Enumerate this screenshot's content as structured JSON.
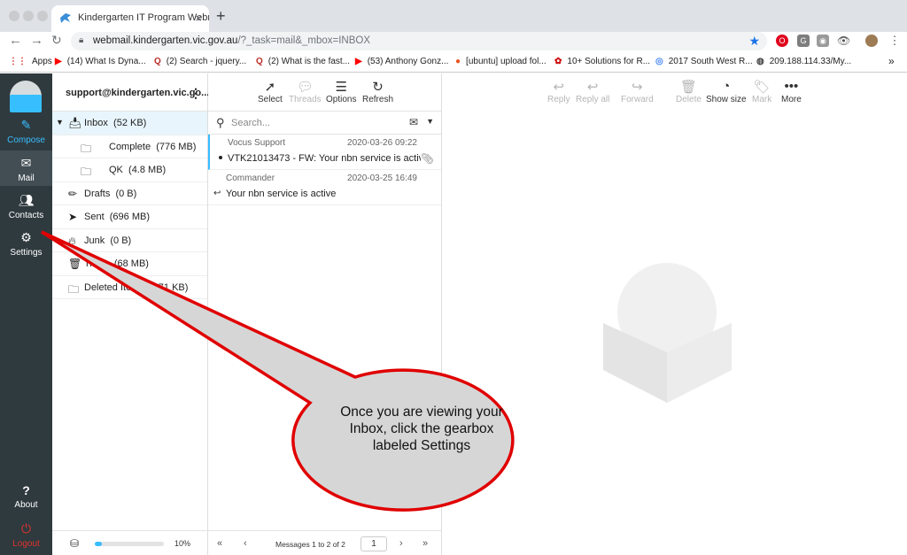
{
  "browser": {
    "tab_title": "Kindergarten IT Program Webmail",
    "url_main": "webmail.kindergarten.vic.gov.au",
    "url_rest": "/?_task=mail&_mbox=INBOX",
    "bookmarks": [
      {
        "icon": "Apps",
        "label": "Apps"
      },
      {
        "label": "(14) What Is Dyna..."
      },
      {
        "label": "(2) Search - jquery..."
      },
      {
        "label": "(2) What is the fast..."
      },
      {
        "label": "(53) Anthony Gonz..."
      },
      {
        "label": "[ubuntu] upload fol..."
      },
      {
        "label": "10+ Solutions for R..."
      },
      {
        "label": "2017 South West R..."
      },
      {
        "label": "209.188.114.33/My..."
      }
    ],
    "more": "»"
  },
  "nav": {
    "compose": "Compose",
    "mail": "Mail",
    "contacts": "Contacts",
    "settings": "Settings",
    "about": "About",
    "logout": "Logout"
  },
  "account": "support@kindergarten.vic.go...",
  "folders": [
    {
      "name": "Inbox",
      "size": "(52 KB)"
    },
    {
      "name": "Complete",
      "size": "(776 MB)"
    },
    {
      "name": "QK",
      "size": "(4.8 MB)"
    },
    {
      "name": "Drafts",
      "size": "(0 B)"
    },
    {
      "name": "Sent",
      "size": "(696 MB)"
    },
    {
      "name": "Junk",
      "size": "(0 B)"
    },
    {
      "name": "Trash",
      "size": "(68 MB)"
    },
    {
      "name": "Deleted Items",
      "size": "(271 KB)"
    }
  ],
  "quota": {
    "percent": 10,
    "label": "10%"
  },
  "list_toolbar": {
    "select": "Select",
    "threads": "Threads",
    "options": "Options",
    "refresh": "Refresh"
  },
  "search_placeholder": "Search...",
  "messages": [
    {
      "from": "Vocus Support",
      "date": "2020-03-26 09:22",
      "subject": "VTK21013473 - FW: Your nbn service is active..."
    },
    {
      "from": "Commander",
      "date": "2020-03-25 16:49",
      "subject": "Your nbn service is active"
    }
  ],
  "pagination": {
    "status": "Messages 1 to 2 of 2",
    "page": "1"
  },
  "preview_toolbar": {
    "reply": "Reply",
    "reply_all": "Reply all",
    "forward": "Forward",
    "delete": "Delete",
    "show_size": "Show size",
    "mark": "Mark",
    "more": "More"
  },
  "callout_text": "Once you are viewing your Inbox, click the gearbox labeled Settings",
  "colors": {
    "accent": "#37beff",
    "callout_border": "#e00000",
    "callout_fill": "#d6d6d6"
  }
}
